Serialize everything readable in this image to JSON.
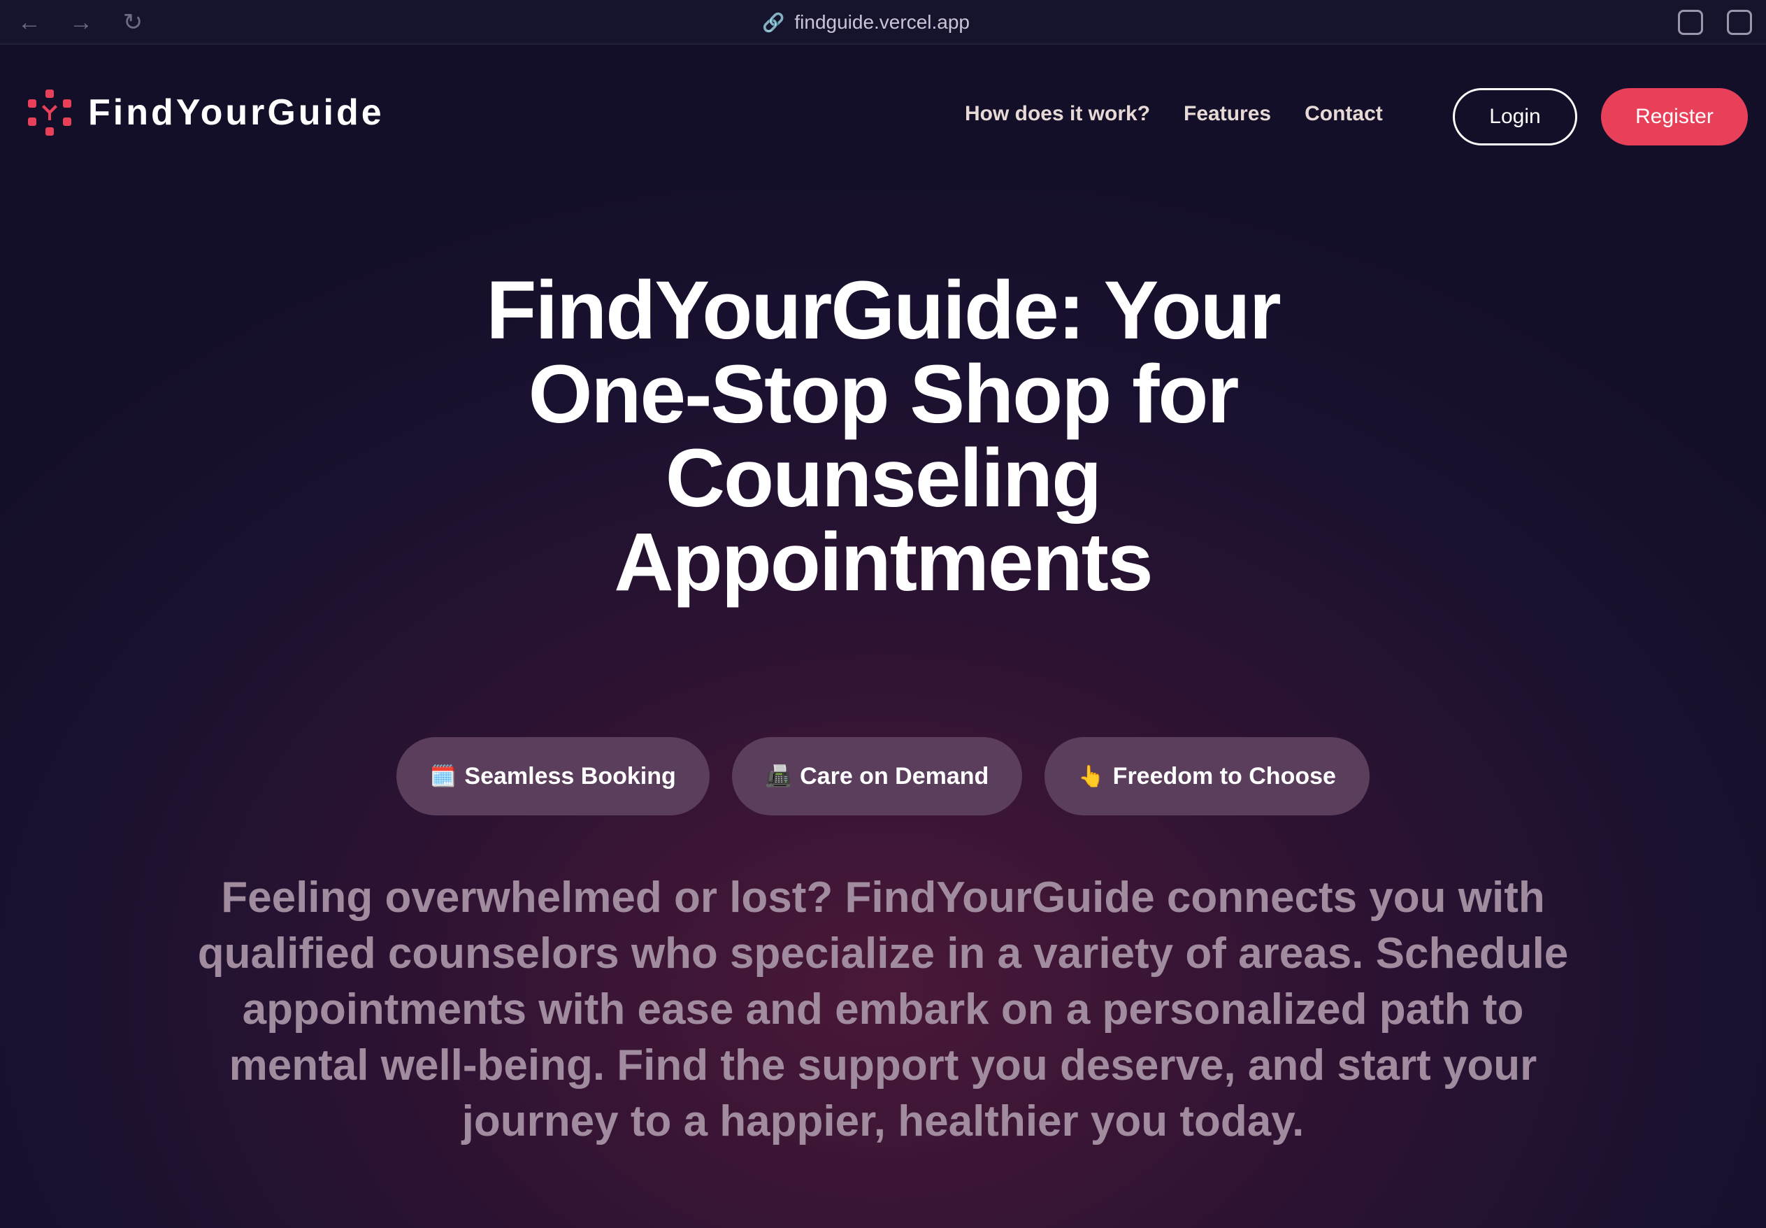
{
  "browser": {
    "url": "findguide.vercel.app",
    "back_icon": "arrow-left-icon",
    "forward_icon": "arrow-right-icon",
    "reload_icon": "reload-icon"
  },
  "nav": {
    "brand": "FindYourGuide",
    "links": [
      "How does it work?",
      "Features",
      "Contact"
    ],
    "login": "Login",
    "register": "Register"
  },
  "hero": {
    "title": "FindYourGuide: Your One-Stop Shop for Counseling Appointments",
    "pills": [
      {
        "icon": "🗓️",
        "label": "Seamless Booking"
      },
      {
        "icon": "📠",
        "label": "Care on Demand"
      },
      {
        "icon": "👆",
        "label": "Freedom to Choose"
      }
    ],
    "description": "Feeling overwhelmed or lost? FindYourGuide connects you with qualified counselors who specialize in a variety of areas. Schedule appointments with ease and embark on a personalized path to mental well-being. Find the support you deserve, and start your journey to a happier, healthier you today."
  },
  "colors": {
    "accent": "#e9405a",
    "background": "#140f28",
    "pill": "#5a3e5c"
  }
}
